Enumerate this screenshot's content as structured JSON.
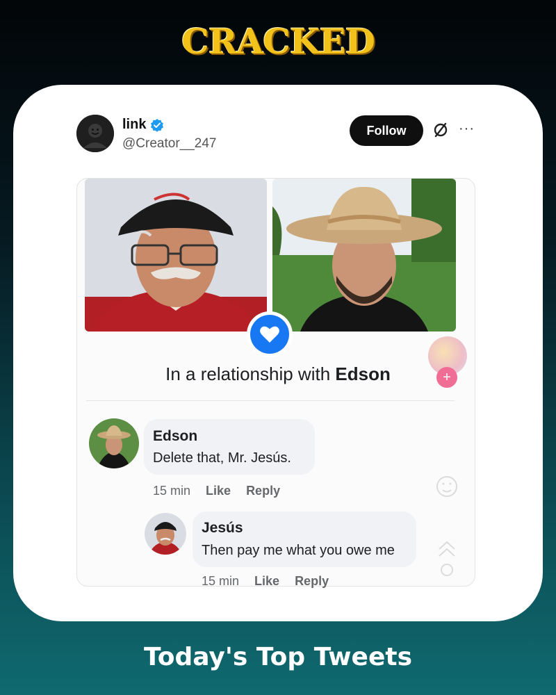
{
  "brand": {
    "logo_text": "CRACKED"
  },
  "post": {
    "display_name": "link",
    "handle": "@Creator__247",
    "follow_label": "Follow",
    "more_label": "···"
  },
  "facebook": {
    "relationship_prefix": "In a relationship with ",
    "relationship_name": "Edson",
    "comments": [
      {
        "author": "Edson",
        "text": "Delete that, Mr. Jesús.",
        "time": "15 min",
        "like": "Like",
        "reply": "Reply"
      },
      {
        "author": "Jesús",
        "text": "Then pay me what you owe me",
        "time": "15 min",
        "like": "Like",
        "reply": "Reply"
      }
    ]
  },
  "footer": {
    "title": "Today's Top Tweets"
  },
  "colors": {
    "brand_gold": "#f3c21a",
    "fb_blue": "#1877f2",
    "verified_blue": "#1d9bf0",
    "button_black": "#0f0f0f"
  },
  "icons": [
    "verified-icon",
    "grok-icon",
    "more-icon",
    "heart-icon",
    "plus-icon"
  ]
}
